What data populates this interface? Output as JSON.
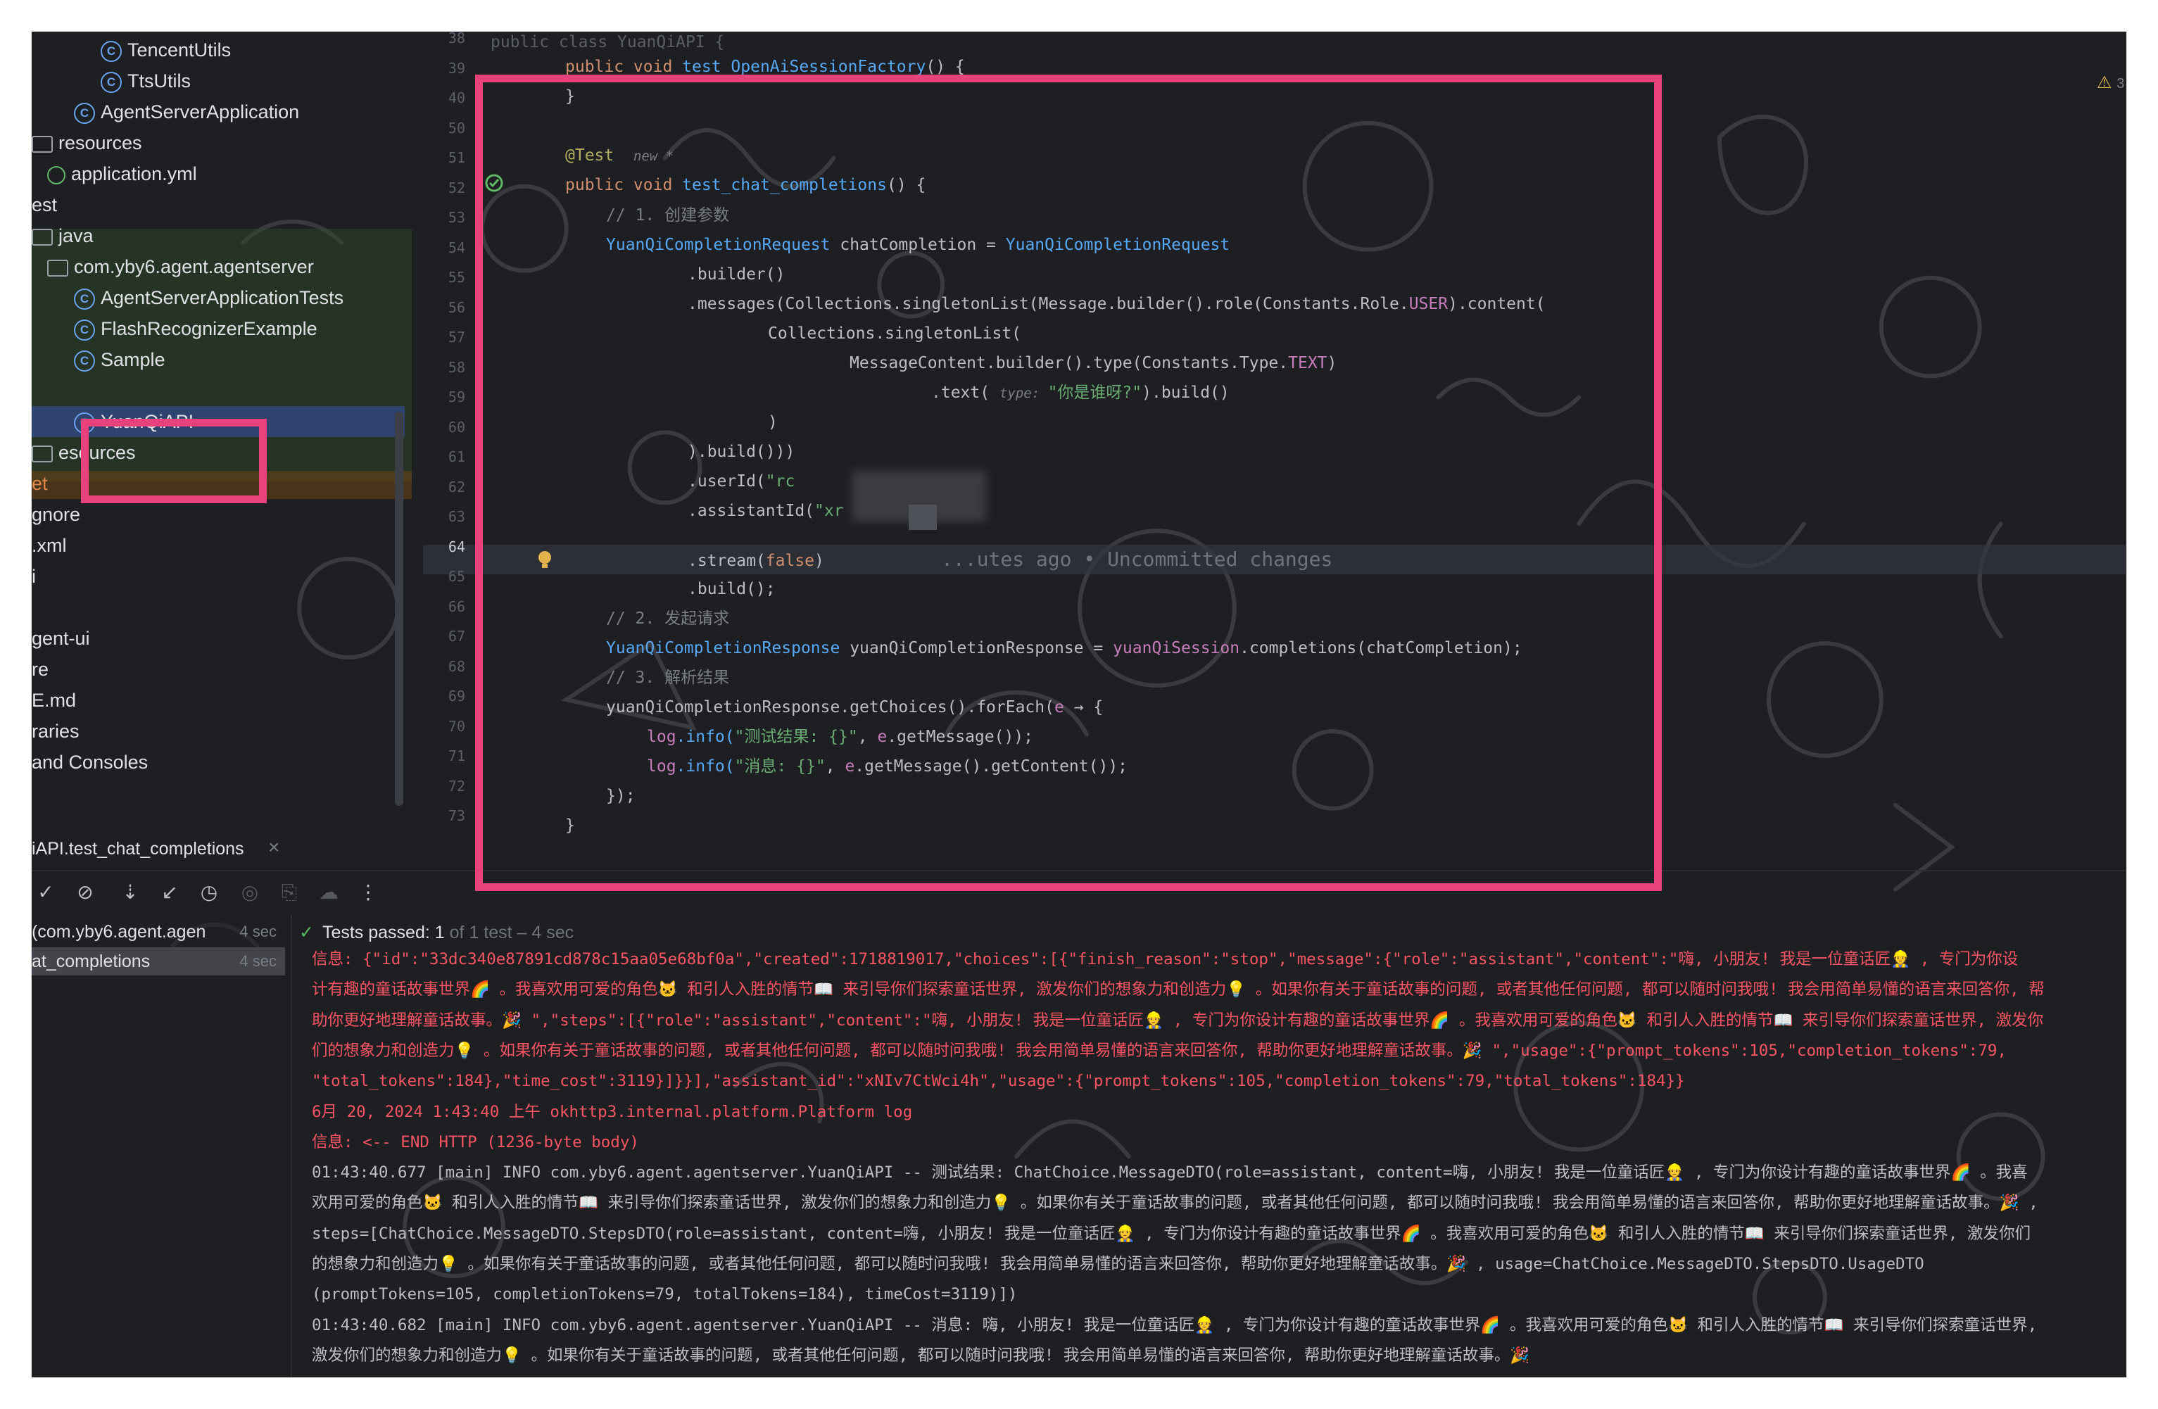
{
  "project_tree": {
    "items": [
      {
        "label": "TencentUtils",
        "icon": "class-icon"
      },
      {
        "label": "TtsUtils",
        "icon": "class-icon"
      },
      {
        "label": "AgentServerApplication",
        "icon": "spring-class-icon"
      },
      {
        "label": "resources",
        "icon": "folder-icon"
      },
      {
        "label": "application.yml",
        "icon": "yaml-icon"
      },
      {
        "label": "est",
        "icon": ""
      },
      {
        "label": "java",
        "icon": "folder-icon"
      },
      {
        "label": "com.yby6.agent.agentserver",
        "icon": "package-icon"
      },
      {
        "label": "AgentServerApplicationTests",
        "icon": "test-class-icon"
      },
      {
        "label": "FlashRecognizerExample",
        "icon": "test-class-icon"
      },
      {
        "label": "Sample",
        "icon": "test-class-icon"
      },
      {
        "label": "YuanQiAPI",
        "icon": "test-class-icon"
      },
      {
        "label": "esources",
        "icon": "folder-icon"
      },
      {
        "label": "et",
        "icon": ""
      },
      {
        "label": "gnore",
        "icon": ""
      },
      {
        "label": ".xml",
        "icon": ""
      },
      {
        "label": "i",
        "icon": ""
      },
      {
        "label": "gent-ui",
        "icon": ""
      },
      {
        "label": "re",
        "icon": ""
      },
      {
        "label": "E.md",
        "icon": ""
      },
      {
        "label": "raries",
        "icon": ""
      },
      {
        "label": "and Consoles",
        "icon": ""
      }
    ]
  },
  "editor": {
    "gutter_numbers": [
      "38",
      "39",
      "40",
      "50",
      "51",
      "52",
      "53",
      "54",
      "55",
      "56",
      "57",
      "58",
      "59",
      "60",
      "61",
      "62",
      "63",
      "64",
      "65",
      "66",
      "67",
      "68",
      "69",
      "70",
      "71",
      "72",
      "73"
    ],
    "class_header": "public class YuanQiAPI {",
    "lines": {
      "l1_kw": "public void ",
      "l1_fn": "test_OpenAiSessionFactory",
      "l1_rest": "() {",
      "l2": "}",
      "l3_ann": "@Test",
      "l3_hint": "new *",
      "l4_kw": "public void ",
      "l4_fn": "test_chat_completions",
      "l4_rest": "() {",
      "l5_cm": "// 1. 创建参数",
      "l6_ty": "YuanQiCompletionRequest",
      "l6_var": " chatCompletion = ",
      "l6_ty2": "YuanQiCompletionRequest",
      "l7": ".builder()",
      "l8_a": ".messages(",
      "l8_b": "Collections.singletonList(Message.builder().role(Constants.Role.",
      "l8_fld": "USER",
      "l8_c": ").content(",
      "l9": "Collections.singletonList(",
      "l10_a": "MessageContent.builder().type(Constants.Type.",
      "l10_fld": "TEXT",
      "l10_b": ")",
      "l11_a": ".text( ",
      "l11_hint": "type: ",
      "l11_str": "\"你是谁呀?\"",
      "l11_b": ").build()",
      "l12": ")",
      "l13": ").build()))",
      "l14_a": ".userId(",
      "l14_str": "\"rc",
      "l15_a": ".assistantId(",
      "l15_str": "\"xr",
      "l16_a": ".stream(",
      "l16_kw": "false",
      "l16_b": ")",
      "l16_blame": "...utes ago • Uncommitted changes",
      "l17": ".build();",
      "l18_cm": "// 2. 发起请求",
      "l19_ty": "YuanQiCompletionResponse",
      "l19_var": " yuanQiCompletionResponse = ",
      "l19_fld": "yuanQiSession",
      "l19_b": ".completions(chatCompletion);",
      "l20_cm": "// 3. 解析结果",
      "l21_a": "yuanQiCompletionResponse.getChoices().forEach(",
      "l21_e": "e",
      "l21_b": " → {",
      "l22_fld": "log",
      "l22_a": ".info(",
      "l22_str": "\"测试结果: {}\"",
      "l22_b": ", ",
      "l22_e": "e",
      "l22_c": ".getMessage());",
      "l23_fld": "log",
      "l23_a": ".info(",
      "l23_str": "\"消息: {}\"",
      "l23_b": ", ",
      "l23_e": "e",
      "l23_c": ".getMessage().getContent());",
      "l24": "});",
      "l25": "}"
    },
    "warning_count": "3"
  },
  "run_panel": {
    "tab_label": "iAPI.test_chat_completions",
    "tree": [
      {
        "label": "(com.yby6.agent.agen",
        "time": "4 sec"
      },
      {
        "label": "at_completions",
        "time": "4 sec"
      }
    ],
    "status": {
      "label": "Tests passed: ",
      "count": "1",
      "suffix": " of 1 test – 4 sec"
    },
    "log_lines": [
      {
        "style": "err",
        "text": "信息: {\"id\":\"33dc340e87891cd878c15aa05e68bf0a\",\"created\":1718819017,\"choices\":[{\"finish_reason\":\"stop\",\"message\":{\"role\":\"assistant\",\"content\":\"嗨, 小朋友! 我是一位童话匠👷 , 专门为你设"
      },
      {
        "style": "err",
        "text": "计有趣的童话故事世界🌈 。我喜欢用可爱的角色🐱 和引人入胜的情节📖 来引导你们探索童话世界, 激发你们的想象力和创造力💡 。如果你有关于童话故事的问题, 或者其他任何问题, 都可以随时问我哦! 我会用简单易懂的语言来回答你, 帮"
      },
      {
        "style": "err",
        "text": "助你更好地理解童话故事。🎉 \",\"steps\":[{\"role\":\"assistant\",\"content\":\"嗨, 小朋友! 我是一位童话匠👷 , 专门为你设计有趣的童话故事世界🌈 。我喜欢用可爱的角色🐱 和引人入胜的情节📖 来引导你们探索童话世界, 激发你"
      },
      {
        "style": "err",
        "text": "们的想象力和创造力💡 。如果你有关于童话故事的问题, 或者其他任何问题, 都可以随时问我哦! 我会用简单易懂的语言来回答你, 帮助你更好地理解童话故事。🎉 \",\"usage\":{\"prompt_tokens\":105,\"completion_tokens\":79,"
      },
      {
        "style": "err",
        "text": "\"total_tokens\":184},\"time_cost\":3119}]}}],\"assistant_id\":\"xNIv7CtWci4h\",\"usage\":{\"prompt_tokens\":105,\"completion_tokens\":79,\"total_tokens\":184}}"
      },
      {
        "style": "err",
        "text": "6月 20, 2024 1:43:40 上午 okhttp3.internal.platform.Platform log"
      },
      {
        "style": "err",
        "text": "信息: <-- END HTTP (1236-byte body)"
      },
      {
        "style": "info",
        "text": "01:43:40.677 [main] INFO com.yby6.agent.agentserver.YuanQiAPI -- 测试结果: ChatChoice.MessageDTO(role=assistant, content=嗨, 小朋友! 我是一位童话匠👷 , 专门为你设计有趣的童话故事世界🌈 。我喜"
      },
      {
        "style": "info",
        "text": "欢用可爱的角色🐱 和引人入胜的情节📖 来引导你们探索童话世界, 激发你们的想象力和创造力💡 。如果你有关于童话故事的问题, 或者其他任何问题, 都可以随时问我哦! 我会用简单易懂的语言来回答你, 帮助你更好地理解童话故事。🎉 ,"
      },
      {
        "style": "info",
        "text": "steps=[ChatChoice.MessageDTO.StepsDTO(role=assistant, content=嗨, 小朋友! 我是一位童话匠👷 , 专门为你设计有趣的童话故事世界🌈 。我喜欢用可爱的角色🐱 和引人入胜的情节📖 来引导你们探索童话世界, 激发你们"
      },
      {
        "style": "info",
        "text": "的想象力和创造力💡 。如果你有关于童话故事的问题, 或者其他任何问题, 都可以随时问我哦! 我会用简单易懂的语言来回答你, 帮助你更好地理解童话故事。🎉 , usage=ChatChoice.MessageDTO.StepsDTO.UsageDTO"
      },
      {
        "style": "info",
        "text": "(promptTokens=105, completionTokens=79, totalTokens=184), timeCost=3119)])"
      },
      {
        "style": "info",
        "text": "01:43:40.682 [main] INFO com.yby6.agent.agentserver.YuanQiAPI -- 消息: 嗨, 小朋友! 我是一位童话匠👷 , 专门为你设计有趣的童话故事世界🌈 。我喜欢用可爱的角色🐱 和引人入胜的情节📖 来引导你们探索童话世界,"
      },
      {
        "style": "info",
        "text": "激发你们的想象力和创造力💡 。如果你有关于童话故事的问题, 或者其他任何问题, 都可以随时问我哦! 我会用简单易懂的语言来回答你, 帮助你更好地理解童话故事。🎉"
      }
    ]
  },
  "colors": {
    "annotation_border": "#e8417c",
    "background": "#1e1f22",
    "selection": "#2e436e",
    "error_log": "#f75464",
    "success": "#5fb865"
  }
}
